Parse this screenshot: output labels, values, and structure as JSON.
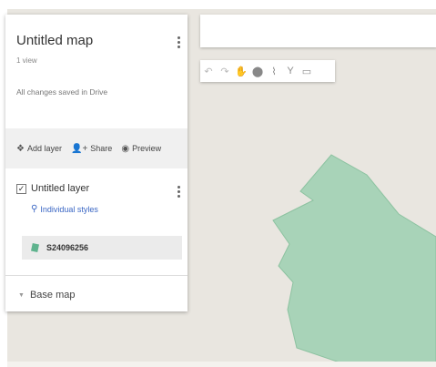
{
  "map": {
    "title": "Untitled map",
    "views": "1 view",
    "save_status": "All changes saved in Drive"
  },
  "actions": [
    {
      "label": "Add layer",
      "icon": "add-layer-icon"
    },
    {
      "label": "Share",
      "icon": "share-icon"
    },
    {
      "label": "Preview",
      "icon": "preview-icon"
    }
  ],
  "layer": {
    "name": "Untitled layer",
    "checked": true,
    "style_link": "Individual styles",
    "features": [
      {
        "label": "S24096256",
        "color": "#5fb38e"
      }
    ]
  },
  "base_map": {
    "label": "Base map"
  },
  "toolbar": {
    "tools": [
      "undo-icon",
      "redo-icon",
      "hand-icon",
      "marker-icon",
      "draw-line-icon",
      "directions-icon",
      "ruler-icon"
    ]
  },
  "colors": {
    "map_background": "#e9e6e0",
    "polygon_fill": "#a8d3b8",
    "polygon_stroke": "#8cc2a0",
    "link": "#3a66c4"
  }
}
